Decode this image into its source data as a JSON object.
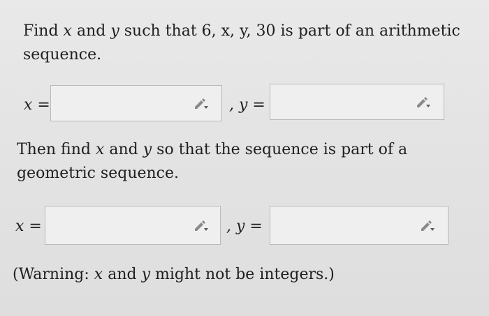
{
  "question1": {
    "prefix": "Find ",
    "x_var": "x",
    "and1": " and ",
    "y_var": "y",
    "suffix": " such that 6, x, y, 30 is part of an arithmetic sequence."
  },
  "question2": {
    "prefix": "Then find ",
    "x_var": "x",
    "and1": " and ",
    "y_var": "y",
    "suffix": " so that the sequence is part of a geometric sequence."
  },
  "answers": {
    "x_label": "x =",
    "y_label": ", y =",
    "arith_x_value": "",
    "arith_y_value": "",
    "geo_x_value": "",
    "geo_y_value": ""
  },
  "warning": {
    "prefix": "(Warning: ",
    "x_var": "x",
    "middle": " and ",
    "y_var": "y",
    "suffix": " might not be integers.)"
  },
  "icons": {
    "answer_edit": "pencil-dropdown-icon"
  }
}
